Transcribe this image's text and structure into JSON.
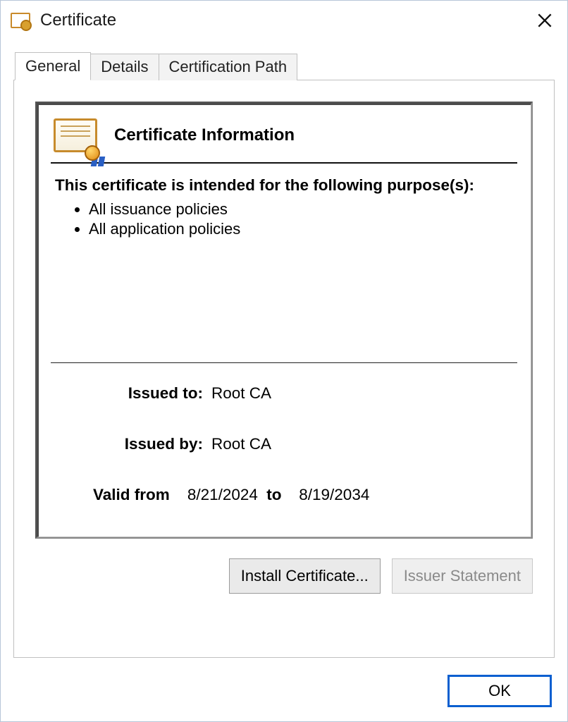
{
  "window": {
    "title": "Certificate"
  },
  "tabs": [
    {
      "label": "General",
      "active": true
    },
    {
      "label": "Details",
      "active": false
    },
    {
      "label": "Certification Path",
      "active": false
    }
  ],
  "cert": {
    "info_title": "Certificate Information",
    "purpose_intro": "This certificate is intended for the following purpose(s):",
    "purposes": [
      "All issuance policies",
      "All application policies"
    ],
    "issued_to_label": "Issued to:",
    "issued_to": "Root CA",
    "issued_by_label": "Issued by:",
    "issued_by": "Root CA",
    "valid_from_label": "Valid from",
    "valid_from": "8/21/2024",
    "valid_to_label": "to",
    "valid_to": "8/19/2034"
  },
  "buttons": {
    "install": "Install Certificate...",
    "issuer_statement": "Issuer Statement",
    "ok": "OK"
  }
}
